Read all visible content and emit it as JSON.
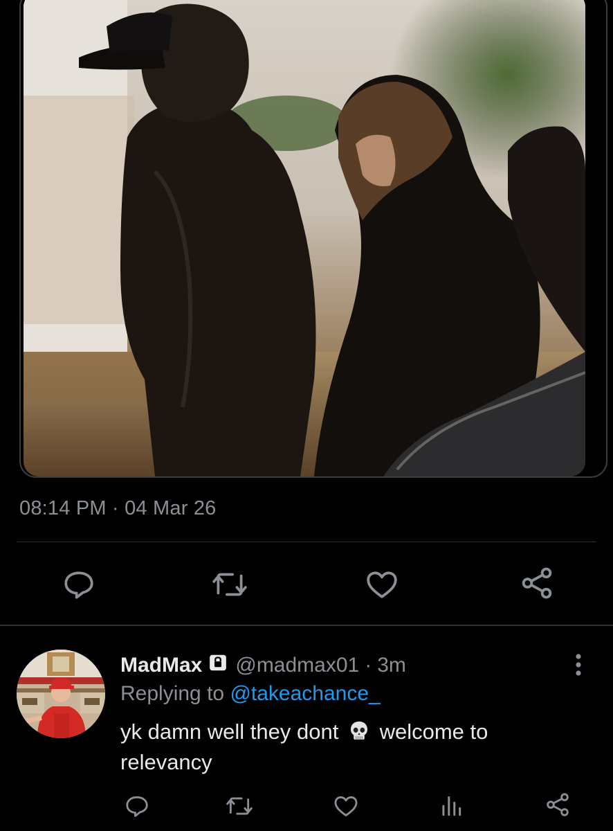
{
  "tweet": {
    "timestamp": "08:14 PM · 04 Mar 26",
    "actions": {
      "reply": "reply-icon",
      "retweet": "retweet-icon",
      "like": "heart-icon",
      "share": "share-icon"
    }
  },
  "reply": {
    "display_name": "MadMax",
    "handle": "@madmax01",
    "separator": "·",
    "age": "3m",
    "replying_prefix": "Replying to ",
    "replying_handle": "@takeachance_",
    "text_before_emoji": "yk damn well they dont",
    "text_after_emoji": "welcome to relevancy",
    "emoji": "skull-icon",
    "actions": {
      "reply": "reply-icon",
      "retweet": "retweet-icon",
      "like": "heart-icon",
      "views": "analytics-icon",
      "share": "share-icon"
    }
  },
  "colors": {
    "background": "#000000",
    "text": "#e7e9ea",
    "muted": "#8b9096",
    "link": "#1d9bf0",
    "divider": "#2f3336"
  }
}
